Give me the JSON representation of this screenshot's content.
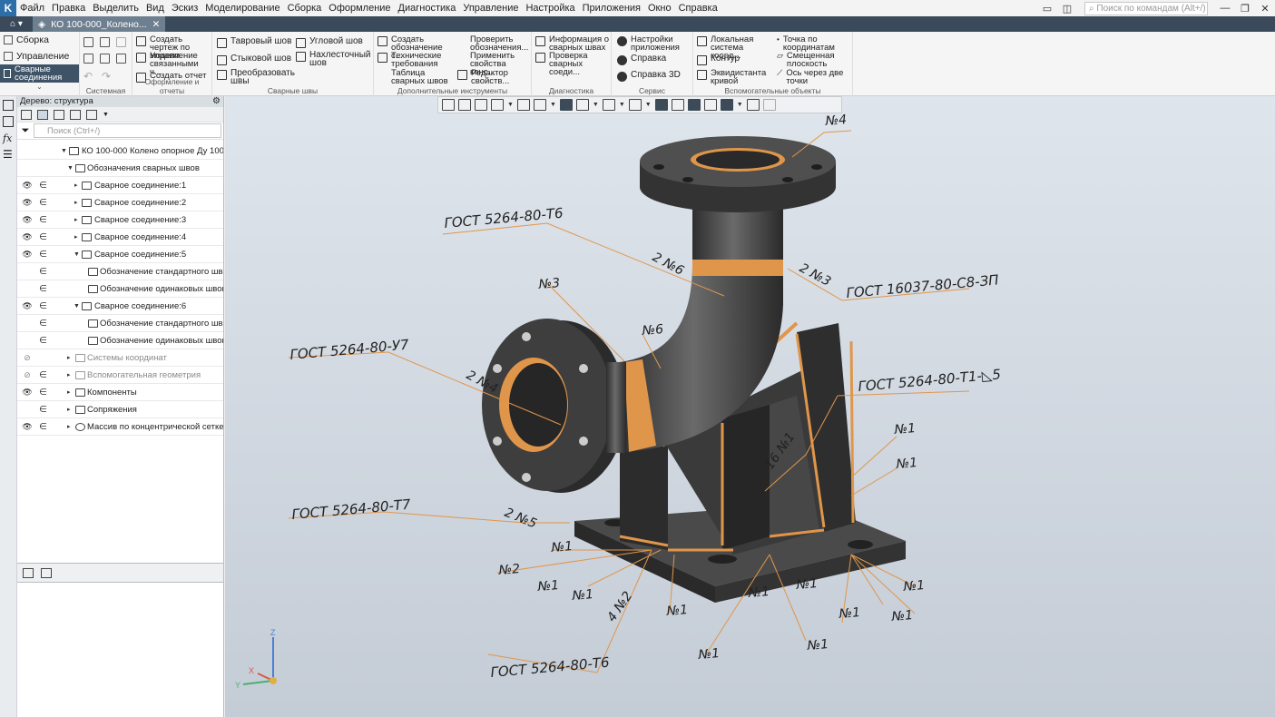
{
  "menu": [
    "Файл",
    "Правка",
    "Выделить",
    "Вид",
    "Эскиз",
    "Моделирование",
    "Сборка",
    "Оформление",
    "Диагностика",
    "Управление",
    "Настройка",
    "Приложения",
    "Окно",
    "Справка"
  ],
  "search_commands": "Поиск по командам (Alt+/)",
  "tab": {
    "title": "КО 100-000_Колено..."
  },
  "ribbon": {
    "modes": [
      "Сборка",
      "Управление",
      "Сварные соединения"
    ],
    "groups": {
      "system": "Системная",
      "design": "Оформление и отчеты",
      "welds": "Сварные швы",
      "extra": "Дополнительные инструменты",
      "diag": "Диагностика",
      "service": "Сервис",
      "aux": "Вспомогательные объекты"
    },
    "buttons": {
      "create_drawing": "Создать чертеж по модели",
      "manage_linked": "Управление связанными ч...",
      "create_report": "Создать отчет",
      "tee": "Тавровый шов",
      "corner": "Угловой шов",
      "butt": "Стыковой шов",
      "overlap": "Нахлесточный шов",
      "convert": "Преобразовать швы",
      "create_notation": "Создать обозначение с...",
      "check_notation": "Проверить обозначения...",
      "tech_req": "Технические требования",
      "apply_props": "Применить свойства конс...",
      "weld_table": "Таблица сварных швов",
      "props_editor": "Редактор свойств...",
      "weld_info": "Информация о сварных швах",
      "weld_check": "Проверка сварных соеди...",
      "app_settings": "Настройки приложения",
      "help": "Справка",
      "help3d": "Справка 3D",
      "local_cs": "Локальная система коорд...",
      "contour": "Контур",
      "equidistant": "Эквидистанта кривой",
      "point_coords": "Точка по координатам",
      "offset_plane": "Смещенная плоскость",
      "axis_two_points": "Ось через две точки"
    }
  },
  "tree": {
    "title": "Дерево: структура",
    "search_placeholder": "Поиск (Ctrl+/)",
    "rows": [
      "КО 100-000 Колено опорное Ду 100 (",
      "Обозначения сварных швов",
      "Сварное соединение:1",
      "Сварное соединение:2",
      "Сварное соединение:3",
      "Сварное соединение:4",
      "Сварное соединение:5",
      "Обозначение стандартного шва п",
      "Обозначение одинаковых швов п",
      "Сварное соединение:6",
      "Обозначение стандартного шва п",
      "Обозначение одинаковых швов п",
      "Системы координат",
      "Вспомогательная геометрия",
      "Компоненты",
      "Сопряжения",
      "Массив по концентрической сетке:1"
    ]
  },
  "annotations": {
    "gost_t6_top": "ГОСТ 5264-80-Т6",
    "gost_16037": "ГОСТ 16037-80-С8-ЗП",
    "gost_u7": "ГОСТ 5264-80-У7",
    "gost_t1": "ГОСТ 5264-80-Т1-◺5",
    "gost_t7": "ГОСТ 5264-80-Т7",
    "gost_t6_bottom": "ГОСТ 5264-80-Т6",
    "n4": "№4",
    "two_n6": "2 №6",
    "two_n3": "2 №3",
    "n3": "№3",
    "n6": "№6",
    "two_n4": "2 №4",
    "sixteen_n1": "16 №1",
    "two_n5": "2 №5",
    "n1": "№1",
    "n2": "№2",
    "four_n2": "4 №2"
  },
  "triad": {
    "z": "Z",
    "x": "X",
    "y": "Y"
  },
  "colors": {
    "weld": "#e0964a",
    "metal_dark": "#3b3b3b",
    "metal_mid": "#555555",
    "accent": "#3e5366"
  }
}
